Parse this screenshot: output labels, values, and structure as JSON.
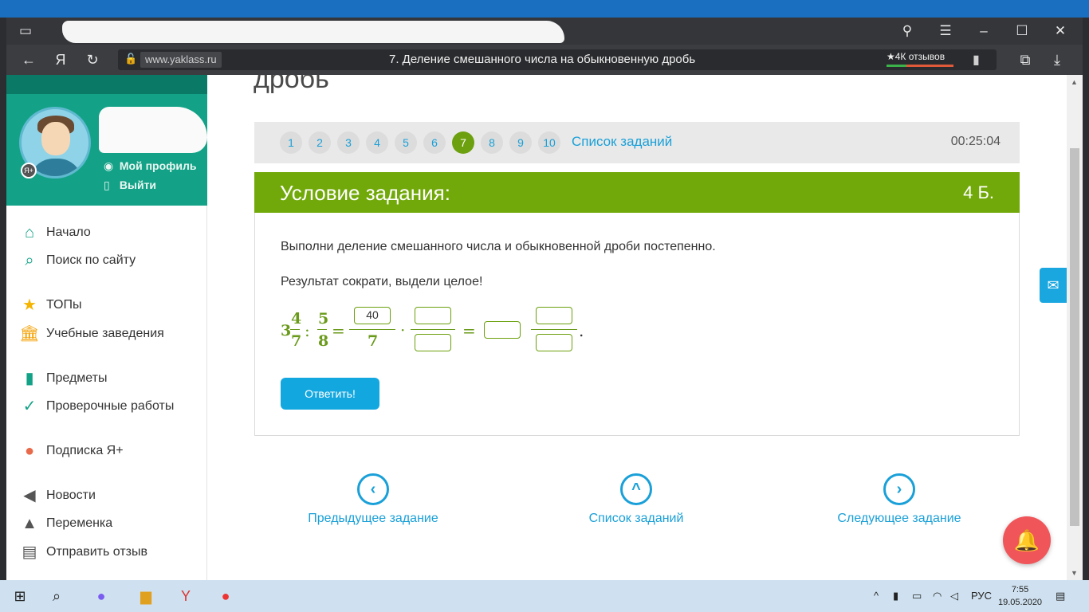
{
  "browser": {
    "domain": "www.yaklass.ru",
    "page_title": "7. Деление смешанного числа на обыкновенную дробь",
    "reviews": "★4К отзывов",
    "yandex_letter": "Я"
  },
  "profile": {
    "my_profile": "Мой профиль",
    "logout": "Выйти",
    "badge": "Я+"
  },
  "menu": {
    "items": [
      {
        "label": "Начало",
        "icon": "home-icon"
      },
      {
        "label": "Поиск по сайту",
        "icon": "search-icon"
      },
      {
        "label": "ТОПы",
        "icon": "star-icon"
      },
      {
        "label": "Учебные заведения",
        "icon": "institution-icon"
      },
      {
        "label": "Предметы",
        "icon": "book-icon"
      },
      {
        "label": "Проверочные работы",
        "icon": "check-circle-icon"
      },
      {
        "label": "Подписка Я+",
        "icon": "ya-plus-icon"
      },
      {
        "label": "Новости",
        "icon": "megaphone-icon"
      },
      {
        "label": "Переменка",
        "icon": "bell-icon"
      },
      {
        "label": "Отправить отзыв",
        "icon": "chat-icon"
      }
    ]
  },
  "main": {
    "heading_cut": "дробь",
    "steps": [
      "1",
      "2",
      "3",
      "4",
      "5",
      "6",
      "7",
      "8",
      "9",
      "10"
    ],
    "active_step": 7,
    "step_list_link": "Список заданий",
    "timer": "00:25:04",
    "task_title": "Условие задания:",
    "points": "4 Б.",
    "instruction1": "Выполни деление смешанного числа и обыкновенной дроби постепенно.",
    "instruction2": "Результат сократи, выдели целое!",
    "math": {
      "whole": "3",
      "num1": "4",
      "den1": "7",
      "num2": "5",
      "den2": "8",
      "op_div": ":",
      "op_eq": "=",
      "op_mul": "·",
      "filled_numerator": "40",
      "filled_denominator": "7",
      "period": "."
    },
    "answer_button": "Ответить!",
    "prev_task": "Предыдущее задание",
    "task_list": "Список заданий",
    "next_task": "Следующее задание"
  },
  "taskbar": {
    "lang": "РУС",
    "time": "7:55",
    "date": "19.05.2020"
  },
  "colors": {
    "green_header": "#72a90a",
    "teal_profile": "#13a287",
    "link_blue": "#1aa0d8",
    "button_blue": "#13a7e0",
    "bell_red": "#f0555a"
  }
}
